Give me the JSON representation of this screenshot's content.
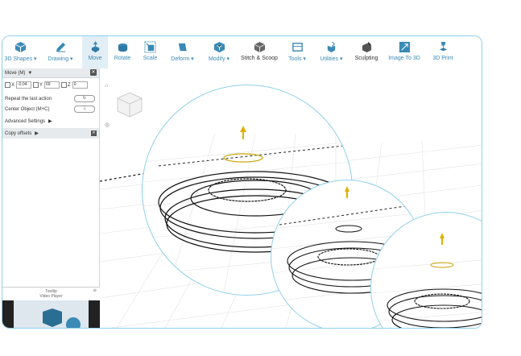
{
  "toolbar": {
    "items": [
      {
        "label": "3D Shapes ▾",
        "icon": "cube-icon"
      },
      {
        "label": "Drawing ▾",
        "icon": "pen-icon"
      },
      {
        "label": "Move",
        "icon": "move-icon",
        "active": true
      },
      {
        "label": "Rotate",
        "icon": "rotate-icon"
      },
      {
        "label": "Scale",
        "icon": "scale-icon"
      },
      {
        "label": "Deform ▾",
        "icon": "deform-icon"
      },
      {
        "label": "Modify ▾",
        "icon": "modify-icon"
      },
      {
        "label": "Stitch & Scoop",
        "icon": "stitch-icon"
      },
      {
        "label": "Tools ▾",
        "icon": "tools-icon"
      },
      {
        "label": "Utilities ▾",
        "icon": "utilities-icon"
      },
      {
        "label": "Sculpting",
        "icon": "sculpt-icon"
      },
      {
        "label": "Image To 3D",
        "icon": "image-3d-icon"
      },
      {
        "label": "3D Print",
        "icon": "print-icon"
      }
    ]
  },
  "panel": {
    "title": "Move (M)",
    "x_label": "X",
    "x_value": "-0.04",
    "y_label": "Y",
    "y_value": "69",
    "z_label": "Z",
    "z_value": "0",
    "repeat_label": "Repeat the last action",
    "center_label": "Center Object (M+C)",
    "advanced_label": "Advanced Settings",
    "copy_label": "Copy offsets",
    "tooltip_label": "Tooltip",
    "video_label": "Video Player"
  },
  "colors": {
    "accent": "#3b8ab6",
    "frame": "#8fd0ea",
    "gizmo": "#e0b000"
  }
}
